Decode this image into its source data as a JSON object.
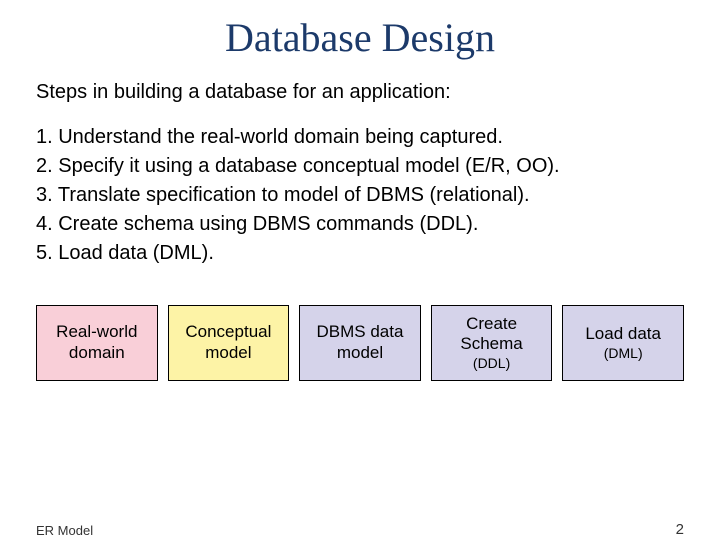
{
  "title": "Database Design",
  "subtitle": "Steps in building a database for an application:",
  "steps": [
    "1. Understand the real-world domain being captured.",
    "2. Specify it using a database conceptual model (E/R, OO).",
    "3. Translate specification to model of DBMS (relational).",
    "4. Create schema using DBMS commands (DDL).",
    "5. Load data (DML)."
  ],
  "boxes": [
    {
      "line1": "Real-world",
      "line2": "domain",
      "sub": ""
    },
    {
      "line1": "Conceptual",
      "line2": "model",
      "sub": ""
    },
    {
      "line1": "DBMS data",
      "line2": "model",
      "sub": ""
    },
    {
      "line1": "Create",
      "line2": "Schema",
      "sub": "(DDL)"
    },
    {
      "line1": "Load data",
      "line2": "",
      "sub": "(DML)"
    }
  ],
  "footer": {
    "left": "ER Model",
    "right": "2"
  }
}
